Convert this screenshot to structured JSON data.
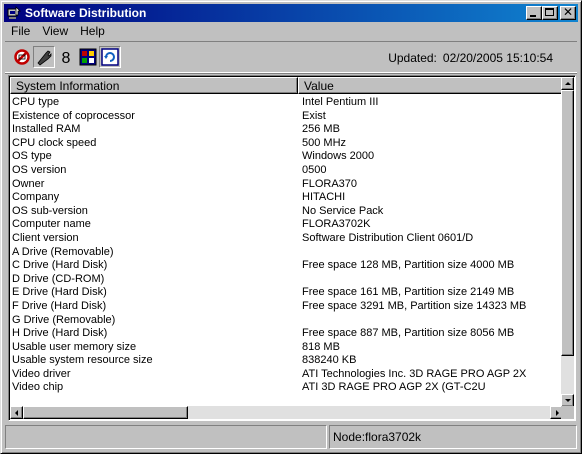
{
  "window": {
    "title": "Software Distribution",
    "colors": {
      "titlebar_start": "#000080",
      "titlebar_end": "#1084d0",
      "face": "#c0c0c0"
    }
  },
  "menu": {
    "items": [
      "File",
      "View",
      "Help"
    ]
  },
  "toolbar": {
    "icons": [
      "stop-icon",
      "wrench-icon",
      "number-8-icon",
      "system-info-icon",
      "refresh-icon"
    ],
    "updated_label": "Updated:",
    "updated_value": "02/20/2005 15:10:54"
  },
  "list": {
    "columns": [
      "System Information",
      "Value"
    ],
    "rows": [
      {
        "key": "CPU type",
        "value": "Intel Pentium III"
      },
      {
        "key": "Existence of coprocessor",
        "value": "Exist"
      },
      {
        "key": "Installed RAM",
        "value": "256 MB"
      },
      {
        "key": "CPU clock speed",
        "value": "500 MHz"
      },
      {
        "key": "OS type",
        "value": "Windows 2000"
      },
      {
        "key": "OS version",
        "value": "0500"
      },
      {
        "key": "Owner",
        "value": "FLORA370"
      },
      {
        "key": "Company",
        "value": "HITACHI"
      },
      {
        "key": "OS sub-version",
        "value": "No Service Pack"
      },
      {
        "key": "Computer name",
        "value": "FLORA3702K"
      },
      {
        "key": "Client version",
        "value": "Software Distribution Client 0601/D"
      },
      {
        "key": "A Drive (Removable)",
        "value": ""
      },
      {
        "key": "C Drive (Hard Disk)",
        "value": "Free space 128 MB,  Partition size 4000 MB"
      },
      {
        "key": "D Drive (CD-ROM)",
        "value": ""
      },
      {
        "key": "E Drive (Hard Disk)",
        "value": "Free space 161 MB,  Partition size 2149 MB"
      },
      {
        "key": "F Drive (Hard Disk)",
        "value": "Free space 3291 MB,  Partition size 14323 MB"
      },
      {
        "key": "G Drive (Removable)",
        "value": ""
      },
      {
        "key": "H Drive (Hard Disk)",
        "value": "Free space 887 MB,  Partition size 8056 MB"
      },
      {
        "key": "Usable user memory size",
        "value": "818 MB"
      },
      {
        "key": "Usable system resource size",
        "value": "838240 KB"
      },
      {
        "key": "Video driver",
        "value": "ATI Technologies Inc. 3D RAGE PRO AGP 2X"
      },
      {
        "key": "Video chip",
        "value": "ATI 3D RAGE PRO AGP 2X (GT-C2U"
      }
    ]
  },
  "status": {
    "left": "",
    "right": "Node:flora3702k"
  }
}
